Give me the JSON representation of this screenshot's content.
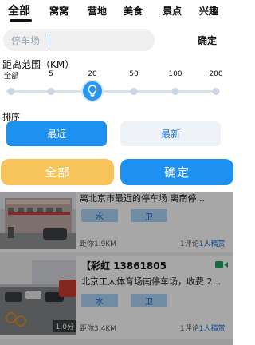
{
  "tabs": [
    {
      "label": "全部",
      "active": true
    },
    {
      "label": "窝窝",
      "active": false
    },
    {
      "label": "营地",
      "active": false
    },
    {
      "label": "美食",
      "active": false
    },
    {
      "label": "景点",
      "active": false
    },
    {
      "label": "兴趣",
      "active": false
    }
  ],
  "search": {
    "value": "停车场"
  },
  "top_confirm_label": "确定",
  "distance": {
    "title": "距离范围（KM）",
    "ticks": [
      "全部",
      "5",
      "20",
      "50",
      "100",
      "200"
    ],
    "selected_index": 2
  },
  "sort": {
    "title": "排序",
    "options": [
      {
        "label": "最近",
        "selected": true
      },
      {
        "label": "最新",
        "selected": false
      }
    ]
  },
  "buttons": {
    "all_label": "全部",
    "confirm_label": "确定"
  },
  "results": [
    {
      "title": "",
      "address": "离北京市最近的停车场 离南停...",
      "amenities": [
        "水",
        "卫"
      ],
      "distance": "距你1.9KM",
      "comments": "1评论",
      "cta": "1人稿赏"
    },
    {
      "title": "【彩虹 13861805",
      "address": "北京工人体育场南停车场，收费 2...",
      "amenities": [
        "水",
        "卫"
      ],
      "distance": "距你3.4KM",
      "comments": "1评论",
      "cta": "1人稿赏",
      "photo_badge": "1.0分"
    }
  ],
  "colors": {
    "accent": "#1e90f0",
    "yellow": "#f7c35b"
  },
  "icons": {
    "slider_thumb": "lightbulb-icon",
    "card_tag": "video-icon"
  }
}
